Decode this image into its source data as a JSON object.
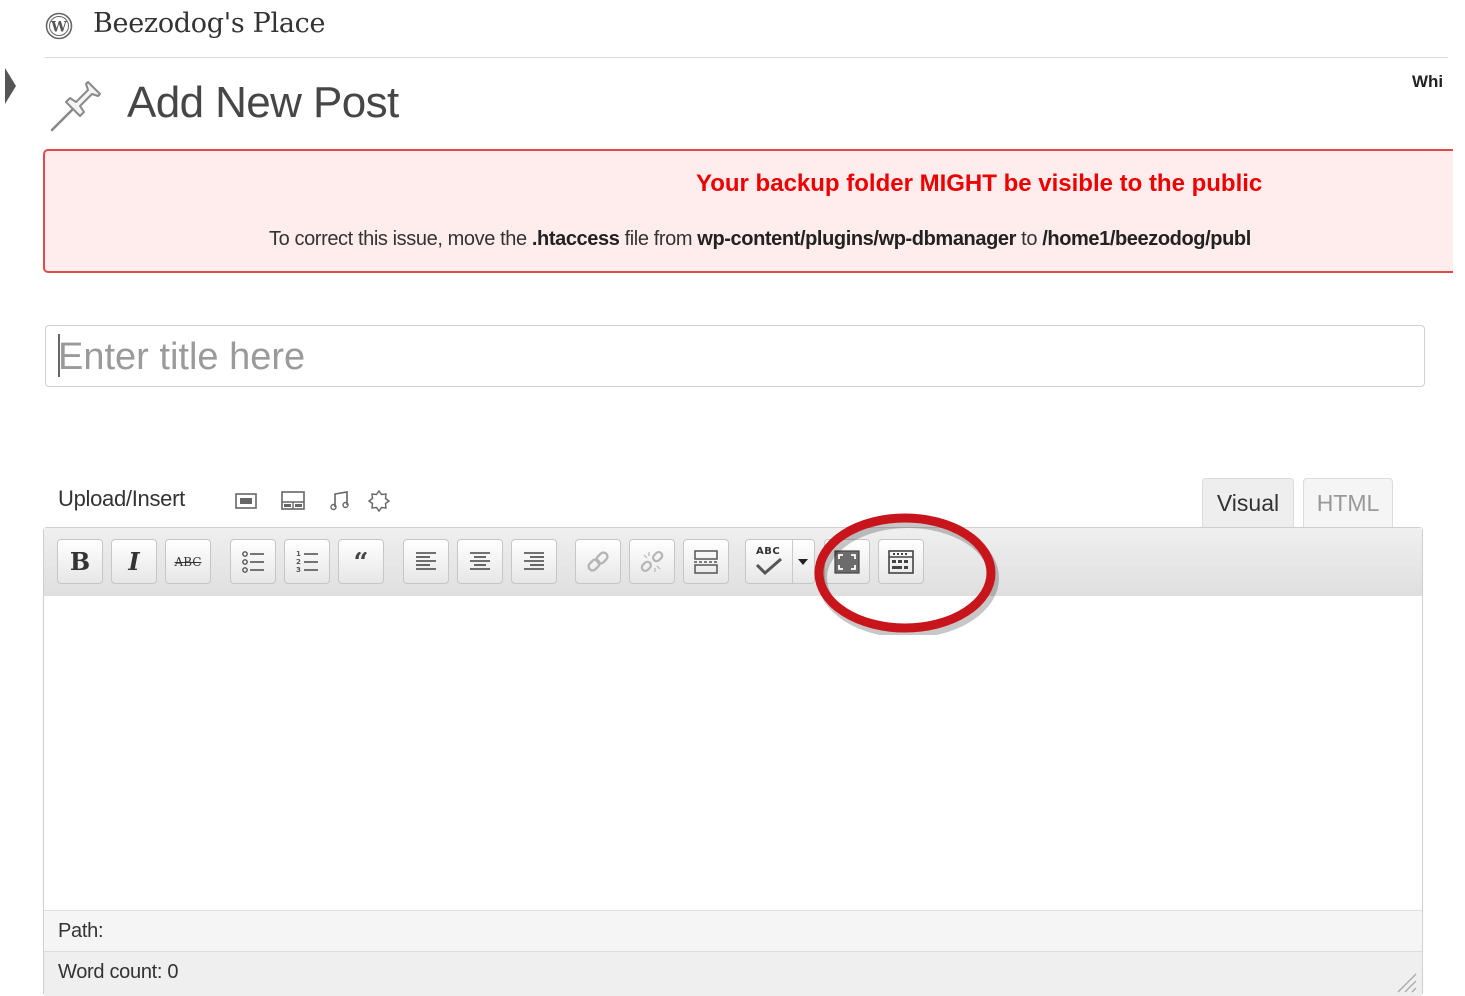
{
  "header": {
    "site_name": "Beezodog's Place",
    "page_title": "Add New Post",
    "screen_options_partial": "Whi"
  },
  "notice": {
    "title": "Your backup folder MIGHT be visible to the public",
    "body_prefix": "To correct this issue, move the ",
    "file_name": ".htaccess",
    "body_middle": " file from ",
    "source_path": "wp-content/plugins/wp-dbmanager",
    "body_to": " to ",
    "dest_path_partial": "/home1/beezodog/publ",
    "background_color": "#ffecec",
    "border_color": "#e14a4a",
    "title_color": "#ee0000"
  },
  "title_field": {
    "placeholder": "Enter title here",
    "value": ""
  },
  "media_bar": {
    "label": "Upload/Insert",
    "icons": [
      "add-image-icon",
      "add-video-icon",
      "add-audio-icon",
      "add-media-icon"
    ]
  },
  "editor_tabs": [
    {
      "label": "Visual",
      "active": true
    },
    {
      "label": "HTML",
      "active": false
    }
  ],
  "toolbar": {
    "buttons": [
      "bold",
      "italic",
      "strikethrough",
      "bullet-list",
      "numbered-list",
      "blockquote",
      "align-left",
      "align-center",
      "align-right",
      "insert-link",
      "remove-link",
      "insert-more-tag",
      "spellcheck",
      "fullscreen",
      "kitchen-sink"
    ],
    "bold_glyph": "B",
    "italic_glyph": "I",
    "strike_glyph": "ABC",
    "spell_glyph": "ABC"
  },
  "status": {
    "path_label": "Path:",
    "word_count_label": "Word count: 0"
  },
  "annotation": {
    "highlighted_button": "kitchen-sink",
    "ring_color": "#c8151b"
  }
}
